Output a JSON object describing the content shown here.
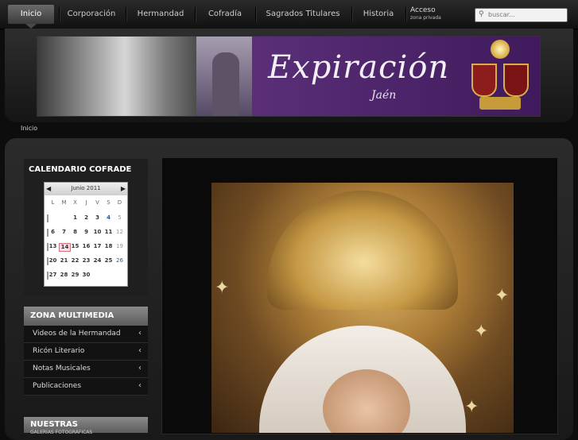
{
  "nav": {
    "items": [
      "Inicio",
      "Corporación",
      "Hermandad",
      "Cofradía",
      "Sagrados Titulares",
      "Historia"
    ],
    "access_label": "Acceso",
    "access_sub": "zona privada",
    "search_placeholder": "buscar..."
  },
  "banner": {
    "title": "Expiración",
    "subtitle": "Jaén"
  },
  "breadcrumb": "Inicio",
  "sidebar": {
    "calendar_title": "CALENDARIO COFRADE",
    "calendar": {
      "month_label": "Junio 2011",
      "prev_symbol": "◀",
      "next_symbol": "▶",
      "weekdays": [
        "L",
        "M",
        "X",
        "J",
        "V",
        "S",
        "D"
      ],
      "weeks": [
        [
          "",
          "",
          "1",
          "2",
          "3",
          "4",
          "5"
        ],
        [
          "6",
          "7",
          "8",
          "9",
          "10",
          "11",
          "12"
        ],
        [
          "13",
          "14",
          "15",
          "16",
          "17",
          "18",
          "19"
        ],
        [
          "20",
          "21",
          "22",
          "23",
          "24",
          "25",
          "26"
        ],
        [
          "27",
          "28",
          "29",
          "30",
          "",
          "",
          ""
        ]
      ],
      "today": "14",
      "highlight_color": "#1a5fb4"
    },
    "multimedia_title": "ZONA MULTIMEDIA",
    "multimedia_items": [
      "Videos de la Hermandad",
      "Ricón Literario",
      "Notas Musicales",
      "Publicaciones"
    ],
    "nuestras_title": "NUESTRAS",
    "nuestras_sub": "GALERÍAS FOTOGRÁFICAS"
  },
  "icons": {
    "search": "search-icon",
    "chevron": "chevron-left-icon"
  }
}
